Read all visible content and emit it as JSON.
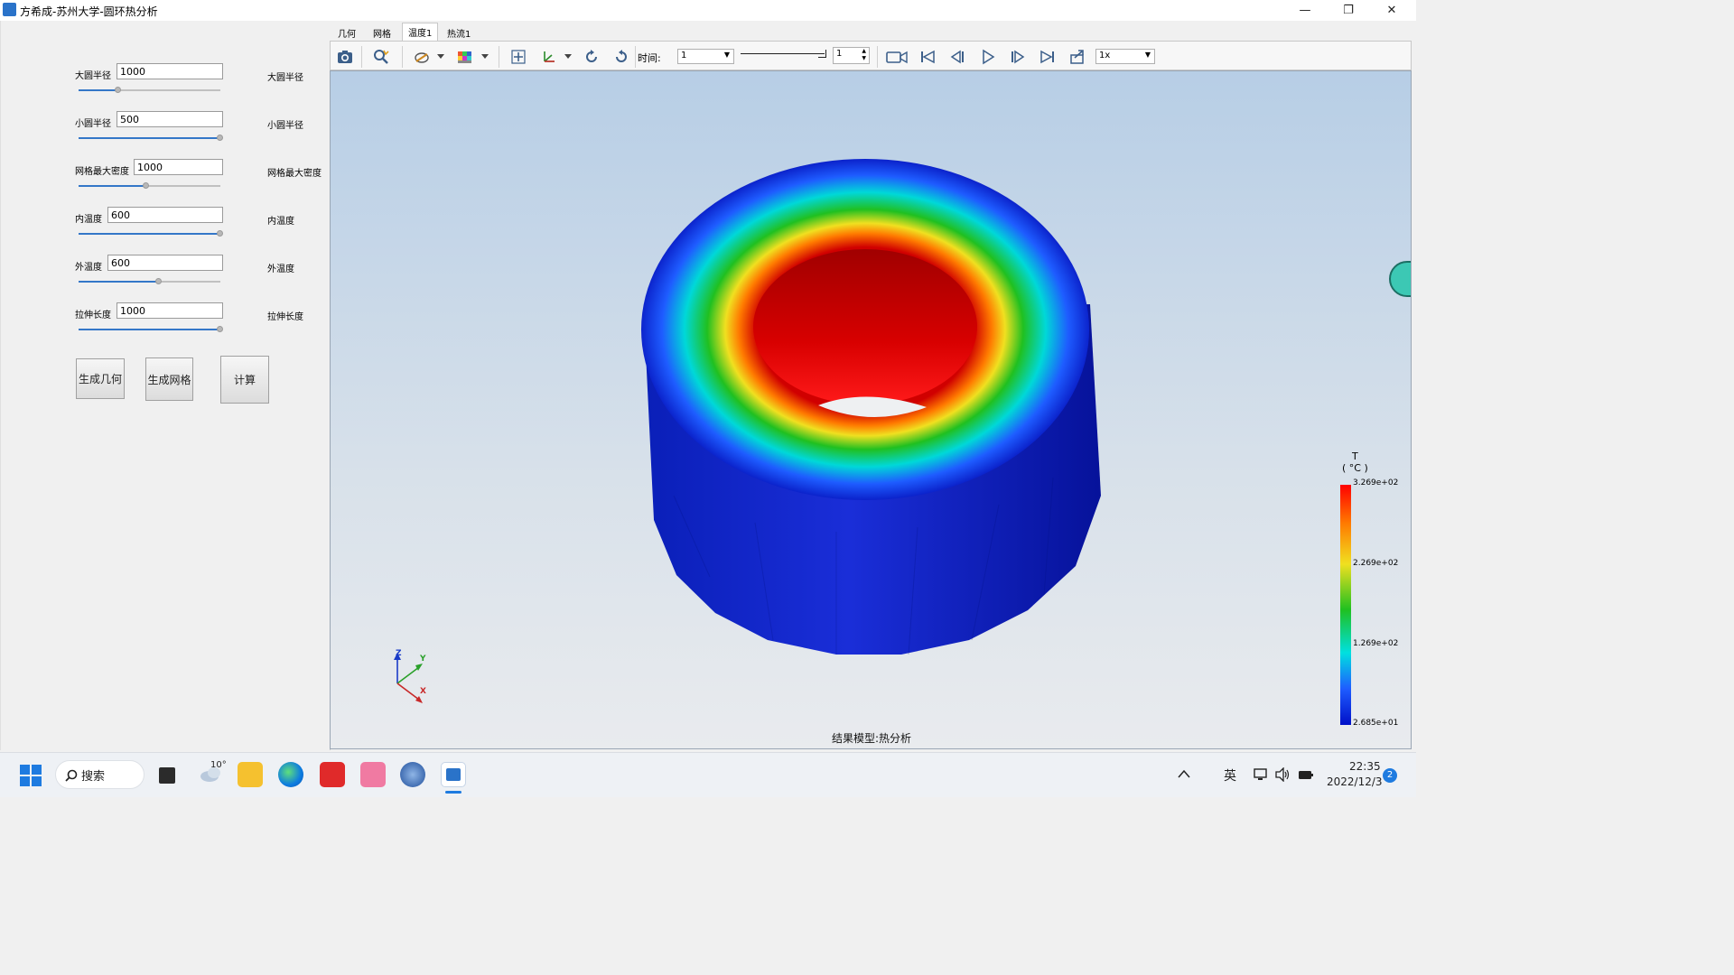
{
  "window": {
    "title": "方希成-苏州大学-圆环热分析",
    "controls": {
      "minimize": "—",
      "restore": "❐",
      "close": "✕"
    }
  },
  "params": [
    {
      "label": "大圆半径",
      "value": "1000",
      "right_label": "大圆半径",
      "slider_fraction": 0.28
    },
    {
      "label": "小圆半径",
      "value": "500",
      "right_label": "小圆半径",
      "slider_fraction": 1.0
    },
    {
      "label": "网格最大密度",
      "value": "1000",
      "right_label": "网格最大密度",
      "slider_fraction": 0.48
    },
    {
      "label": "内温度",
      "value": "600",
      "right_label": "内温度",
      "slider_fraction": 1.0
    },
    {
      "label": "外温度",
      "value": "600",
      "right_label": "外温度",
      "slider_fraction": 0.57
    },
    {
      "label": "拉伸长度",
      "value": "1000",
      "right_label": "拉伸长度",
      "slider_fraction": 1.0
    }
  ],
  "buttons": {
    "gen_geometry": "生成几何",
    "gen_mesh": "生成网格",
    "compute": "计算"
  },
  "tabs": [
    "几何",
    "网格",
    "温度1",
    "热流1"
  ],
  "active_tab": "温度1",
  "toolbar": {
    "time_label": "时间:",
    "time_value": "1",
    "frame_value": "1",
    "speed_value": "1x"
  },
  "viewport": {
    "model_label": "结果模型:热分析",
    "axes": {
      "z": "Z",
      "y": "Y",
      "x": "X"
    }
  },
  "legend": {
    "title_line1": "T",
    "title_line2": "( °C )",
    "tick_max": "3.269e+02",
    "tick_2": "2.269e+02",
    "tick_1": "1.269e+02",
    "tick_min": "2.685e+01"
  },
  "taskbar": {
    "search_label": "搜索",
    "weather_temp": "10°",
    "ime": "英",
    "time": "22:35",
    "date": "2022/12/3",
    "notification_count": "2"
  },
  "colors": {
    "hot": "#d40000",
    "cold": "#0a1fc8",
    "accent": "#3477c8"
  }
}
